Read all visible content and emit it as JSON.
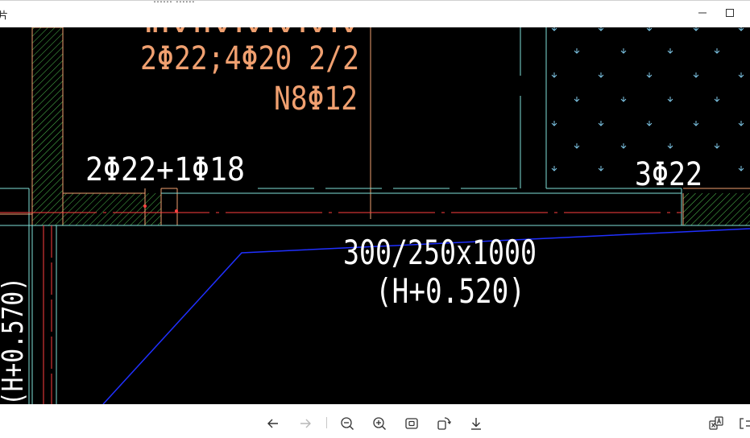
{
  "window": {
    "title": "片",
    "title_fragment": "…… ……",
    "controls": {
      "minimize_icon": "minimize-icon",
      "maximize_icon": "maximize-icon"
    }
  },
  "drawing": {
    "annotations": {
      "rebar_top_partial": "ⅡⅣⅠⅣⅣⅣⅣⅣ",
      "rebar_bottom": "2Φ22;4Φ20 2/2",
      "stirrup": "N8Φ12",
      "beam_rebar_left": "2Φ22+1Φ18",
      "beam_rebar_right": "3Φ22",
      "beam_size": "300/250x1000",
      "beam_elevation": "(H+0.520)",
      "side_label": "(H+0.570)"
    },
    "colors": {
      "background": "#000000",
      "annotation_orange": "#f0a070",
      "annotation_white": "#ffffff",
      "line_cyan": "#7fe0d8",
      "line_red": "#ff4040",
      "line_blue": "#2030ff",
      "hatch_green": "#50c050",
      "arrow_cyan": "#7fc8e8"
    }
  },
  "toolbar": {
    "buttons": [
      {
        "name": "back-button",
        "icon": "arrow-left-icon"
      },
      {
        "name": "forward-button",
        "icon": "arrow-right-icon"
      },
      {
        "name": "zoom-out-button",
        "icon": "zoom-out-icon"
      },
      {
        "name": "zoom-in-button",
        "icon": "zoom-in-icon"
      },
      {
        "name": "fit-window-button",
        "icon": "fit-window-icon"
      },
      {
        "name": "rotate-button",
        "icon": "rotate-icon"
      },
      {
        "name": "download-button",
        "icon": "download-icon"
      },
      {
        "name": "ocr-button",
        "icon": "ocr-text-icon"
      },
      {
        "name": "more-button",
        "icon": "more-icon"
      }
    ]
  }
}
